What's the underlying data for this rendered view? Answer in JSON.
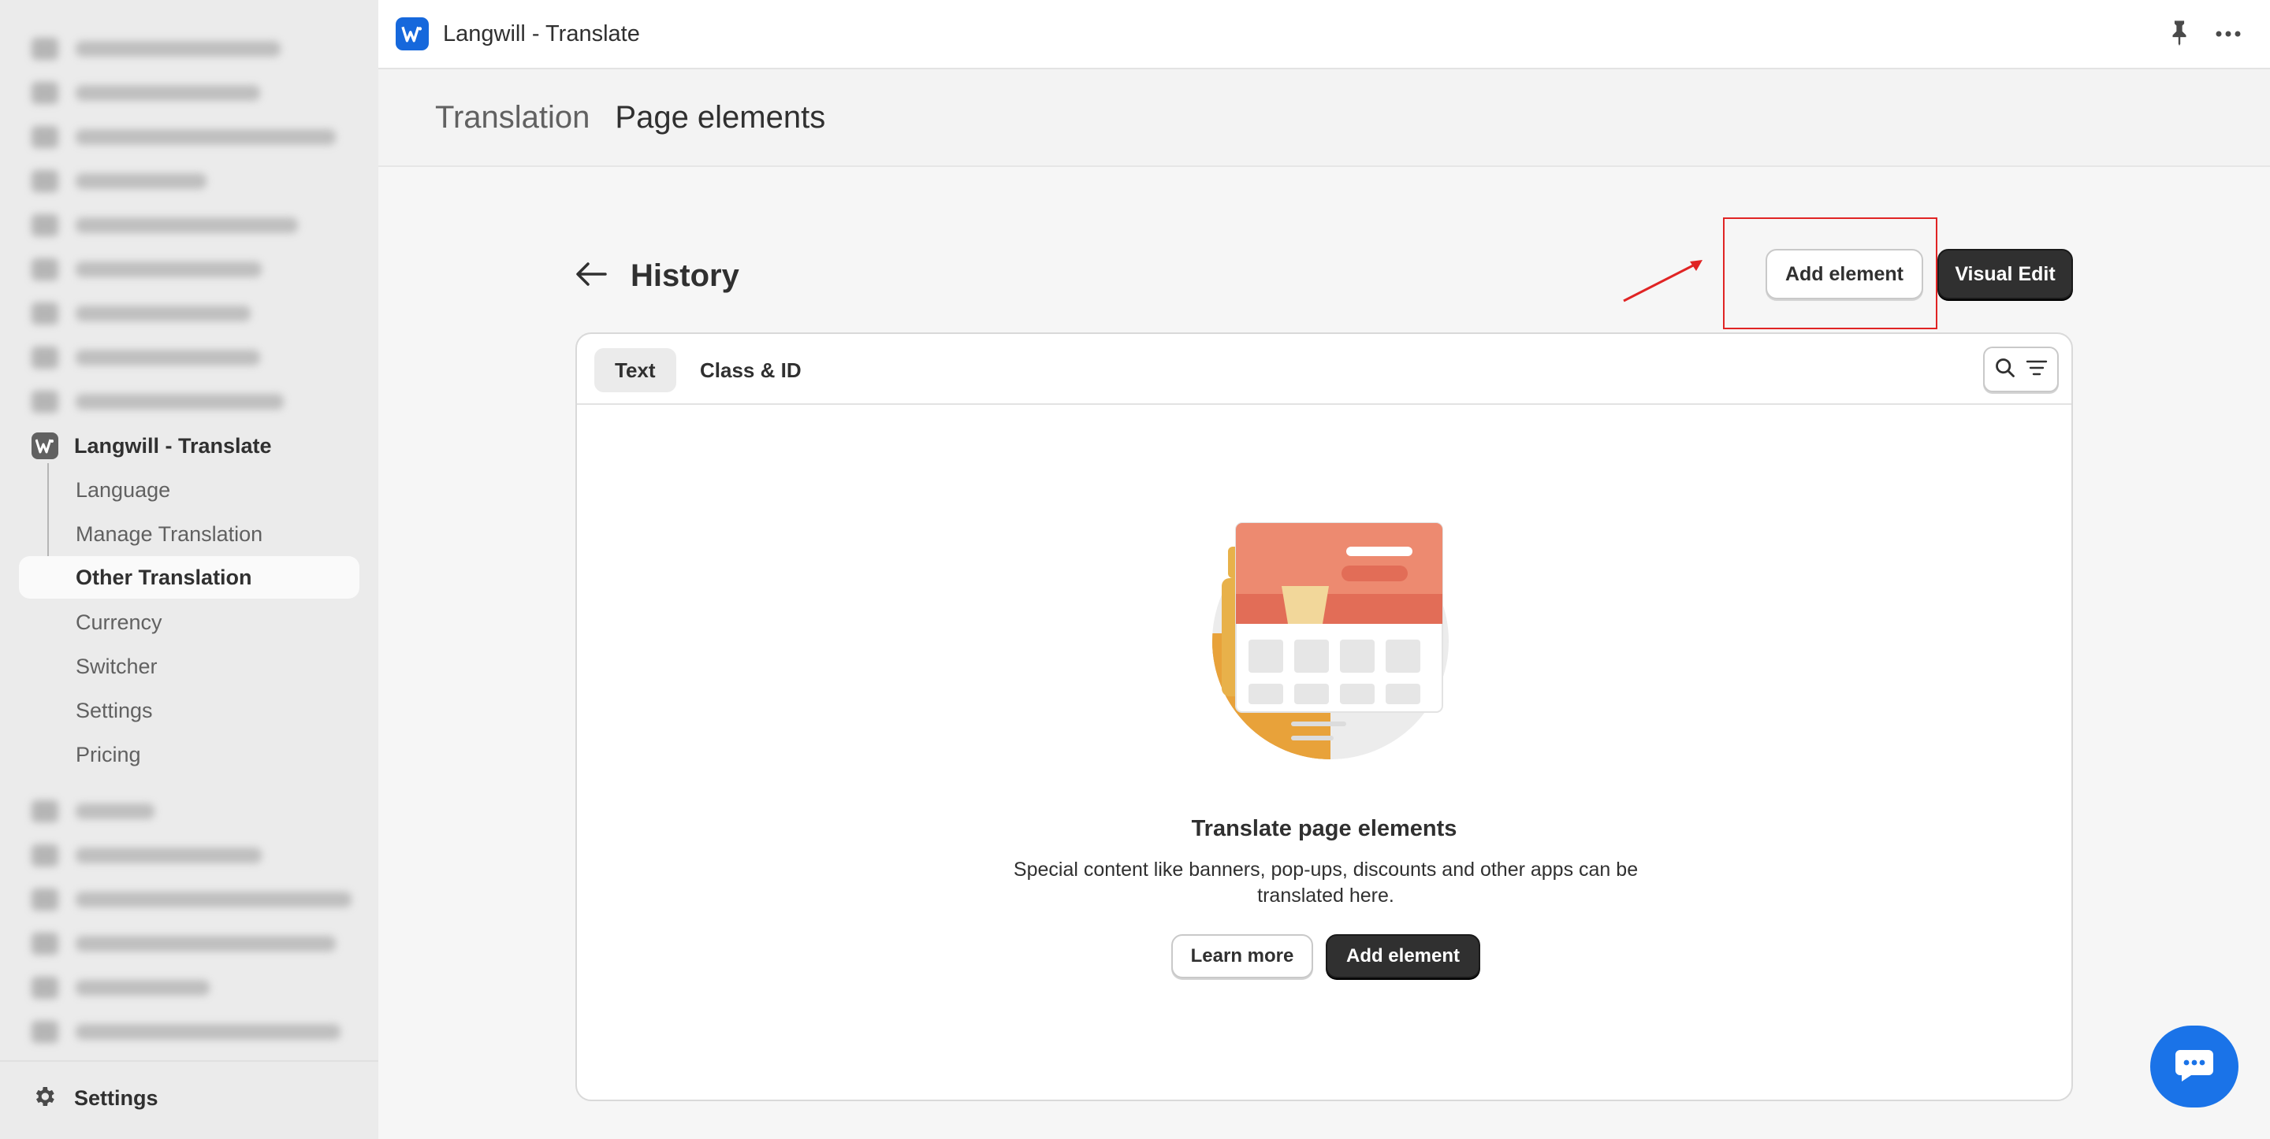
{
  "sidebar": {
    "app_label": "Langwill - Translate",
    "sub_items": [
      {
        "label": "Language"
      },
      {
        "label": "Manage Translation"
      },
      {
        "label": "Other Translation"
      },
      {
        "label": "Currency"
      },
      {
        "label": "Switcher"
      },
      {
        "label": "Settings"
      },
      {
        "label": "Pricing"
      }
    ],
    "active_index": 2,
    "footer_settings": "Settings"
  },
  "topbar": {
    "title": "Langwill - Translate"
  },
  "breadcrumb": {
    "parent": "Translation",
    "current": "Page elements"
  },
  "page": {
    "title": "History",
    "add_element_label": "Add element",
    "visual_edit_label": "Visual Edit"
  },
  "tabs": [
    {
      "label": "Text",
      "active": true
    },
    {
      "label": "Class & ID",
      "active": false
    }
  ],
  "empty_state": {
    "title": "Translate page elements",
    "description": "Special content like banners, pop-ups, discounts and other apps can be translated here.",
    "learn_more_label": "Learn more",
    "add_element_label": "Add element"
  },
  "colors": {
    "accent": "#1668dc",
    "primary_button": "#303030",
    "highlight": "#e02424",
    "chat": "#1a73e8"
  }
}
